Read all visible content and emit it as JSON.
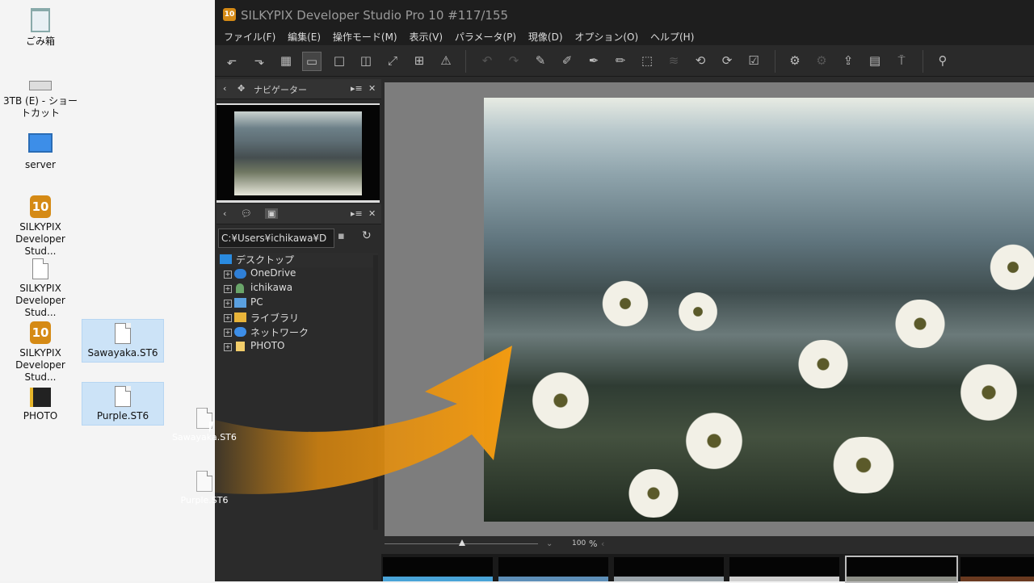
{
  "desktop": {
    "icons": [
      {
        "label": "ごみ箱",
        "icon": "recycle-bin-icon"
      },
      {
        "label": "3TB (E) - ショートカット",
        "icon": "drive-shortcut-icon"
      },
      {
        "label": "server",
        "icon": "computer-icon"
      },
      {
        "label": "SILKYPIX Developer Stud...",
        "icon": "silkypix-10-icon"
      },
      {
        "label": "SILKYPIX Developer Stud...",
        "icon": "file-shortcut-icon"
      },
      {
        "label": "SILKYPIX Developer Stud...",
        "icon": "silkypix-10-icon"
      },
      {
        "label": "Sawayaka.ST6",
        "icon": "file-icon"
      },
      {
        "label": "PHOTO",
        "icon": "folder-icon"
      },
      {
        "label": "Purple.ST6",
        "icon": "file-icon"
      }
    ],
    "dragging": [
      {
        "label": "Sawayaka.ST6"
      },
      {
        "label": "Purple.ST6"
      }
    ]
  },
  "app": {
    "logo_text": "10",
    "title": "SILKYPIX Developer Studio Pro 10   #117/155",
    "menu": [
      "ファイル(F)",
      "編集(E)",
      "操作モード(M)",
      "表示(V)",
      "パラメータ(P)",
      "現像(D)",
      "オプション(O)",
      "ヘルプ(H)"
    ],
    "navigator": {
      "title": "ナビゲーター"
    },
    "browser": {
      "path": "C:¥Users¥ichikawa¥D",
      "tree": [
        {
          "label": "デスクトップ",
          "icon": "desktop-folder-icon",
          "expandable": false
        },
        {
          "label": "OneDrive",
          "icon": "cloud-icon",
          "expandable": true
        },
        {
          "label": "ichikawa",
          "icon": "user-folder-icon",
          "expandable": true
        },
        {
          "label": "PC",
          "icon": "pc-icon",
          "expandable": true
        },
        {
          "label": "ライブラリ",
          "icon": "library-icon",
          "expandable": true
        },
        {
          "label": "ネットワーク",
          "icon": "network-icon",
          "expandable": true
        },
        {
          "label": "PHOTO",
          "icon": "folder-icon",
          "expandable": true
        }
      ]
    },
    "zoom": {
      "value": "100",
      "unit": "%"
    },
    "colors": {
      "accent": "#d58a15",
      "arrow": "#f29b12"
    }
  }
}
